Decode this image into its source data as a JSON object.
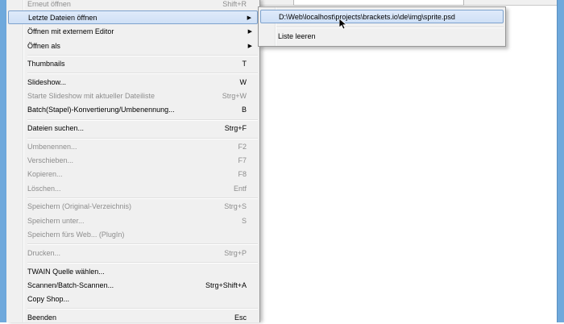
{
  "menu": {
    "items": [
      {
        "label": "Erneut öffnen",
        "shortcut": "Shift+R",
        "disabled": true
      },
      {
        "label": "Letzte Dateien öffnen",
        "shortcut": "",
        "submenu": true,
        "highlighted": true
      },
      {
        "label": "Öffnen mit externem Editor",
        "shortcut": "",
        "submenu": true
      },
      {
        "label": "Öffnen als",
        "shortcut": "",
        "submenu": true
      },
      {
        "label": "Thumbnails",
        "shortcut": "T"
      },
      {
        "label": "Slideshow...",
        "shortcut": "W"
      },
      {
        "label": "Starte Slideshow mit aktueller Dateiliste",
        "shortcut": "Strg+W",
        "disabled": true
      },
      {
        "label": "Batch(Stapel)-Konvertierung/Umbenennung...",
        "shortcut": "B"
      },
      {
        "label": "Dateien suchen...",
        "shortcut": "Strg+F"
      },
      {
        "label": "Umbenennen...",
        "shortcut": "F2",
        "disabled": true
      },
      {
        "label": "Verschieben...",
        "shortcut": "F7",
        "disabled": true
      },
      {
        "label": "Kopieren...",
        "shortcut": "F8",
        "disabled": true
      },
      {
        "label": "Löschen...",
        "shortcut": "Entf",
        "disabled": true
      },
      {
        "label": "Speichern (Original-Verzeichnis)",
        "shortcut": "Strg+S",
        "disabled": true
      },
      {
        "label": "Speichern unter...",
        "shortcut": "S",
        "disabled": true
      },
      {
        "label": "Speichern fürs Web... (PlugIn)",
        "shortcut": "",
        "disabled": true
      },
      {
        "label": "Drucken...",
        "shortcut": "Strg+P",
        "disabled": true
      },
      {
        "label": "TWAIN Quelle wählen...",
        "shortcut": ""
      },
      {
        "label": "Scannen/Batch-Scannen...",
        "shortcut": "Strg+Shift+A"
      },
      {
        "label": "Copy Shop...",
        "shortcut": ""
      },
      {
        "label": "Beenden",
        "shortcut": "Esc"
      }
    ]
  },
  "submenu": {
    "items": [
      {
        "label": "D:\\Web\\localhost\\projects\\brackets.io\\de\\img\\sprite.psd",
        "highlighted": true
      },
      {
        "label": "Liste leeren"
      }
    ]
  },
  "colors": {
    "frame": "#6fa9dc",
    "menu_bg": "#f0f0f0",
    "highlight_border": "#7da2ce",
    "disabled_text": "#8d8d8d"
  }
}
